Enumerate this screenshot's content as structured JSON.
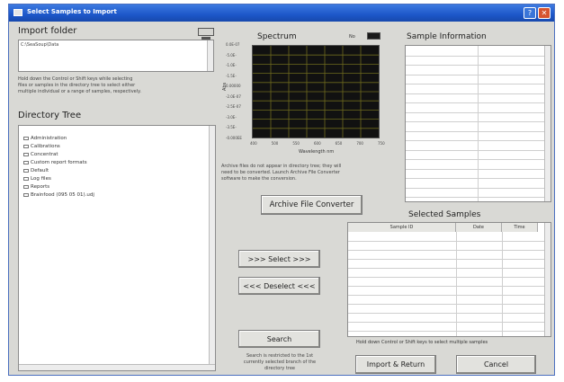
{
  "window": {
    "title": "Select Samples to Import"
  },
  "import_folder": {
    "heading": "Import folder",
    "path": "C:\\SeaSoup\\Data",
    "note_lines": [
      "Hold down the Control or Shift keys while selecting",
      "files or samples in the directory tree to select either",
      "multiple individual or a range of samples, respectively."
    ]
  },
  "directory_tree": {
    "heading": "Directory Tree",
    "items": [
      "Administration",
      "Calibrations",
      "Concentrat",
      "Custom report formats",
      "Default",
      "Log files",
      "Reports",
      "Brainfood (095 05 01).udj"
    ]
  },
  "spectrum": {
    "heading": "Spectrum",
    "legend_label": "No",
    "y_ticks": [
      "0.0E-07",
      "-5.0E-",
      "-1.0E-",
      "-1.5E-",
      "0.00000",
      "-2.0E-07",
      "-2.5E-07",
      "-3.0E-",
      "-3.5E-",
      "-0.000EE"
    ],
    "y_label": "Abs",
    "x_ticks": [
      "400",
      "500",
      "550",
      "600",
      "650",
      "700",
      "750"
    ],
    "x_label": "Wavelength nm"
  },
  "archive_note_lines": [
    "Archive files do not appear in directory tree; they will",
    "need to be converted. Launch Archive File Converter",
    "software to make the conversion."
  ],
  "sample_information": {
    "heading": "Sample Information"
  },
  "buttons": {
    "archive_converter": "Archive File Converter",
    "select": ">>> Select >>>",
    "deselect": "<<< Deselect <<<",
    "search": "Search",
    "import_return": "Import & Return",
    "cancel": "Cancel"
  },
  "search_note_lines": [
    "Search is restricted to the 1st",
    "currently selected branch of the",
    "directory tree"
  ],
  "selected_samples": {
    "heading": "Selected Samples",
    "columns": [
      "Sample ID",
      "Date",
      "Time"
    ],
    "note": "Hold down Control or Shift keys to select multiple samples"
  }
}
